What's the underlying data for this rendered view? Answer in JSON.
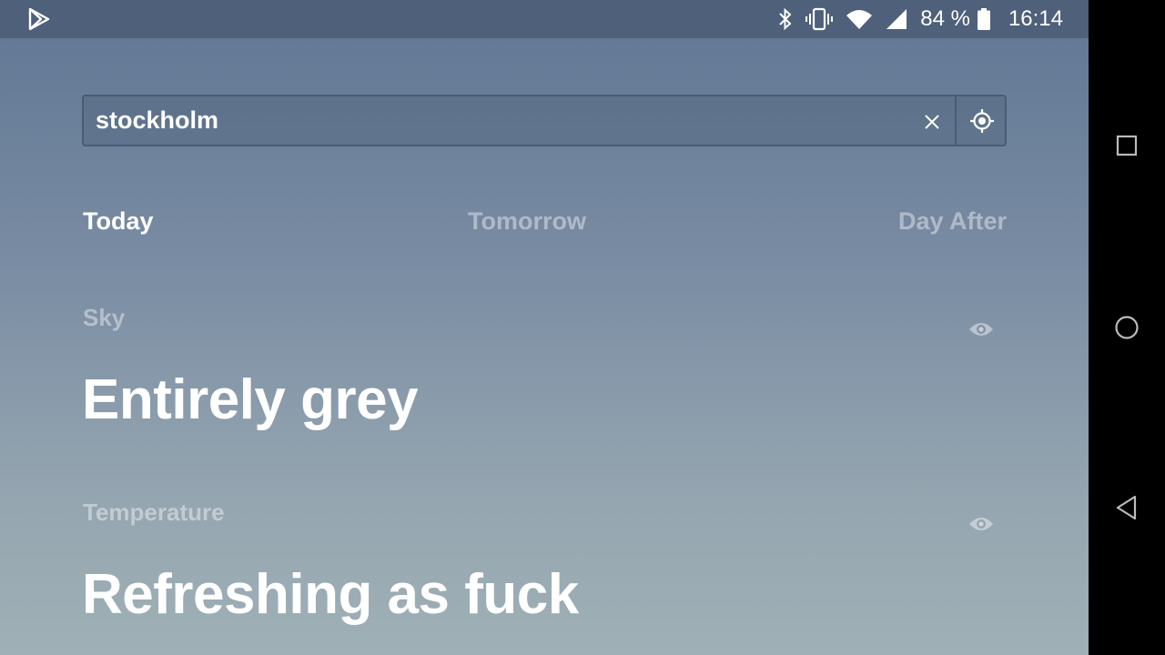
{
  "statusbar": {
    "battery_text": "84 %",
    "time": "16:14",
    "icons": [
      "play-store-icon",
      "bluetooth-icon",
      "vibrate-icon",
      "wifi-icon",
      "signal-icon",
      "battery-icon"
    ]
  },
  "search": {
    "value": "stockholm",
    "placeholder": ""
  },
  "tabs": [
    {
      "label": "Today",
      "active": true
    },
    {
      "label": "Tomorrow",
      "active": false
    },
    {
      "label": "Day After",
      "active": false
    }
  ],
  "sections": [
    {
      "label": "Sky",
      "value": "Entirely grey"
    },
    {
      "label": "Temperature",
      "value": "Refreshing as fuck"
    }
  ],
  "navbar": {
    "icons": [
      "recents-square-icon",
      "home-circle-icon",
      "back-triangle-icon"
    ]
  },
  "colors": {
    "statusbar_bg": "#4e607a",
    "gradient_top": "#5f7693",
    "gradient_bottom": "#9fb0b6",
    "text_primary": "#ffffff"
  }
}
